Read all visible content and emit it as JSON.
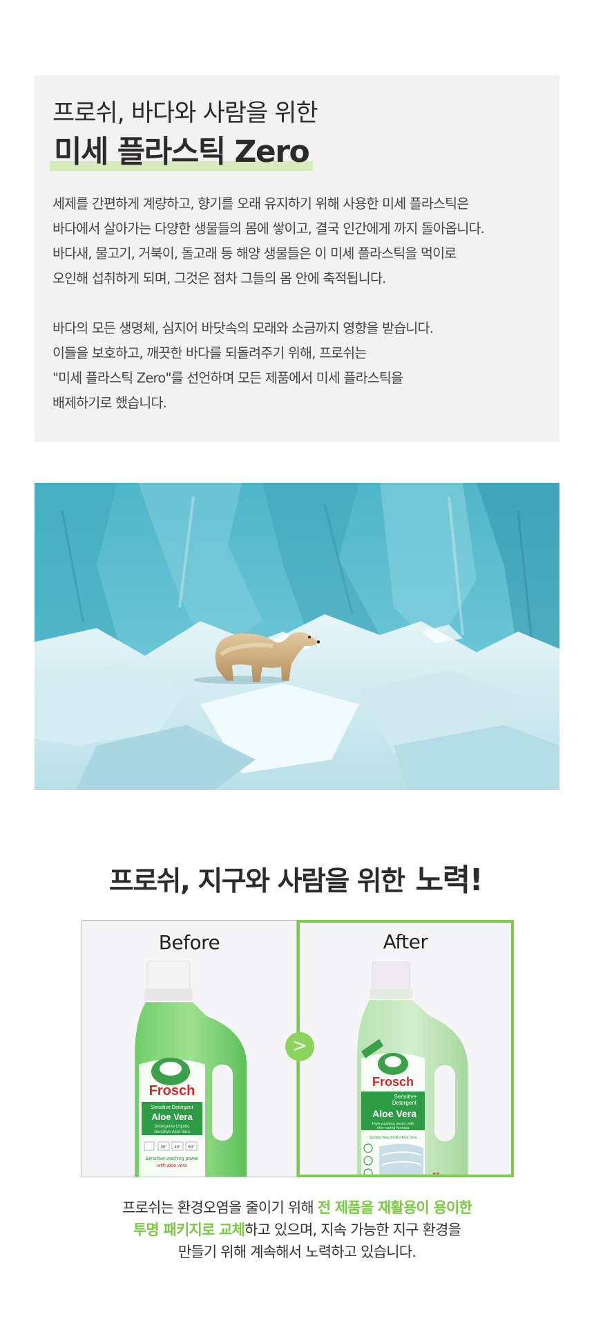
{
  "intro": {
    "subtitle": "프로쉬, 바다와 사람을 위한",
    "title": "미세 플라스틱 Zero",
    "paragraph1": [
      "세제를 간편하게 계량하고, 향기를 오래 유지하기 위해 사용한 미세 플라스틱은",
      "바다에서 살아가는 다양한 생물들의 몸에 쌓이고, 결국 인간에게 까지 돌아옵니다.",
      "바다새, 물고기, 거북이, 돌고래 등 해양 생물들은 이 미세 플라스틱을 먹이로",
      "오인해 섭취하게 되며, 그것은 점차 그들의 몸 안에 축적됩니다."
    ],
    "paragraph2": [
      "바다의 모든 생명체, 심지어 바닷속의 모래와 소금까지 영향을 받습니다.",
      "이들을 보호하고, 깨끗한 바다를 되돌려주기 위해, 프로쉬는",
      "\"미세 플라스틱 Zero\"를 선언하며 모든 제품에서 미세 플라스틱을",
      "배제하기로 했습니다."
    ]
  },
  "effort": {
    "heading_prefix": "프로쉬, 지구와 사람을 위한 ",
    "heading_highlight": "노력!",
    "before_label": "Before",
    "after_label": "After",
    "arrow": ">",
    "bottle_before": {
      "brand": "Frosch",
      "sub": "Sensitive Detergent",
      "product": "Aloe Vera",
      "desc1": "Detergente Líquido",
      "desc2": "Sensitivo Aloe Vera",
      "temps": [
        "30°",
        "40°",
        "60°"
      ],
      "claim1": "Sensitive washing power",
      "claim2": "with aloe vera"
    },
    "bottle_after": {
      "brand": "Frosch",
      "sub1": "Sensitive",
      "sub2": "Detergent",
      "product": "Aloe Vera",
      "desc1": "High washing power with",
      "desc2": "skin-caring formula",
      "desc3": "Sensitiv Waschmittel Aloe Vera",
      "count": "27"
    },
    "closing": {
      "line1_pre": "프로쉬는 환경오염을 줄이기 위해 ",
      "line1_green": "전 제품을 재활용이 용이한",
      "line2_green": "투명 패키지로 교체",
      "line2_post": "하고 있으며, 지속 가능한 지구 환경을",
      "line3": "만들기 위해 계속해서 노력하고 있습니다."
    }
  },
  "colors": {
    "accent_green": "#7ac943",
    "highlight": "#d6ecbd",
    "box_bg": "#f2f2f2",
    "after_border": "#7ccd4b"
  }
}
